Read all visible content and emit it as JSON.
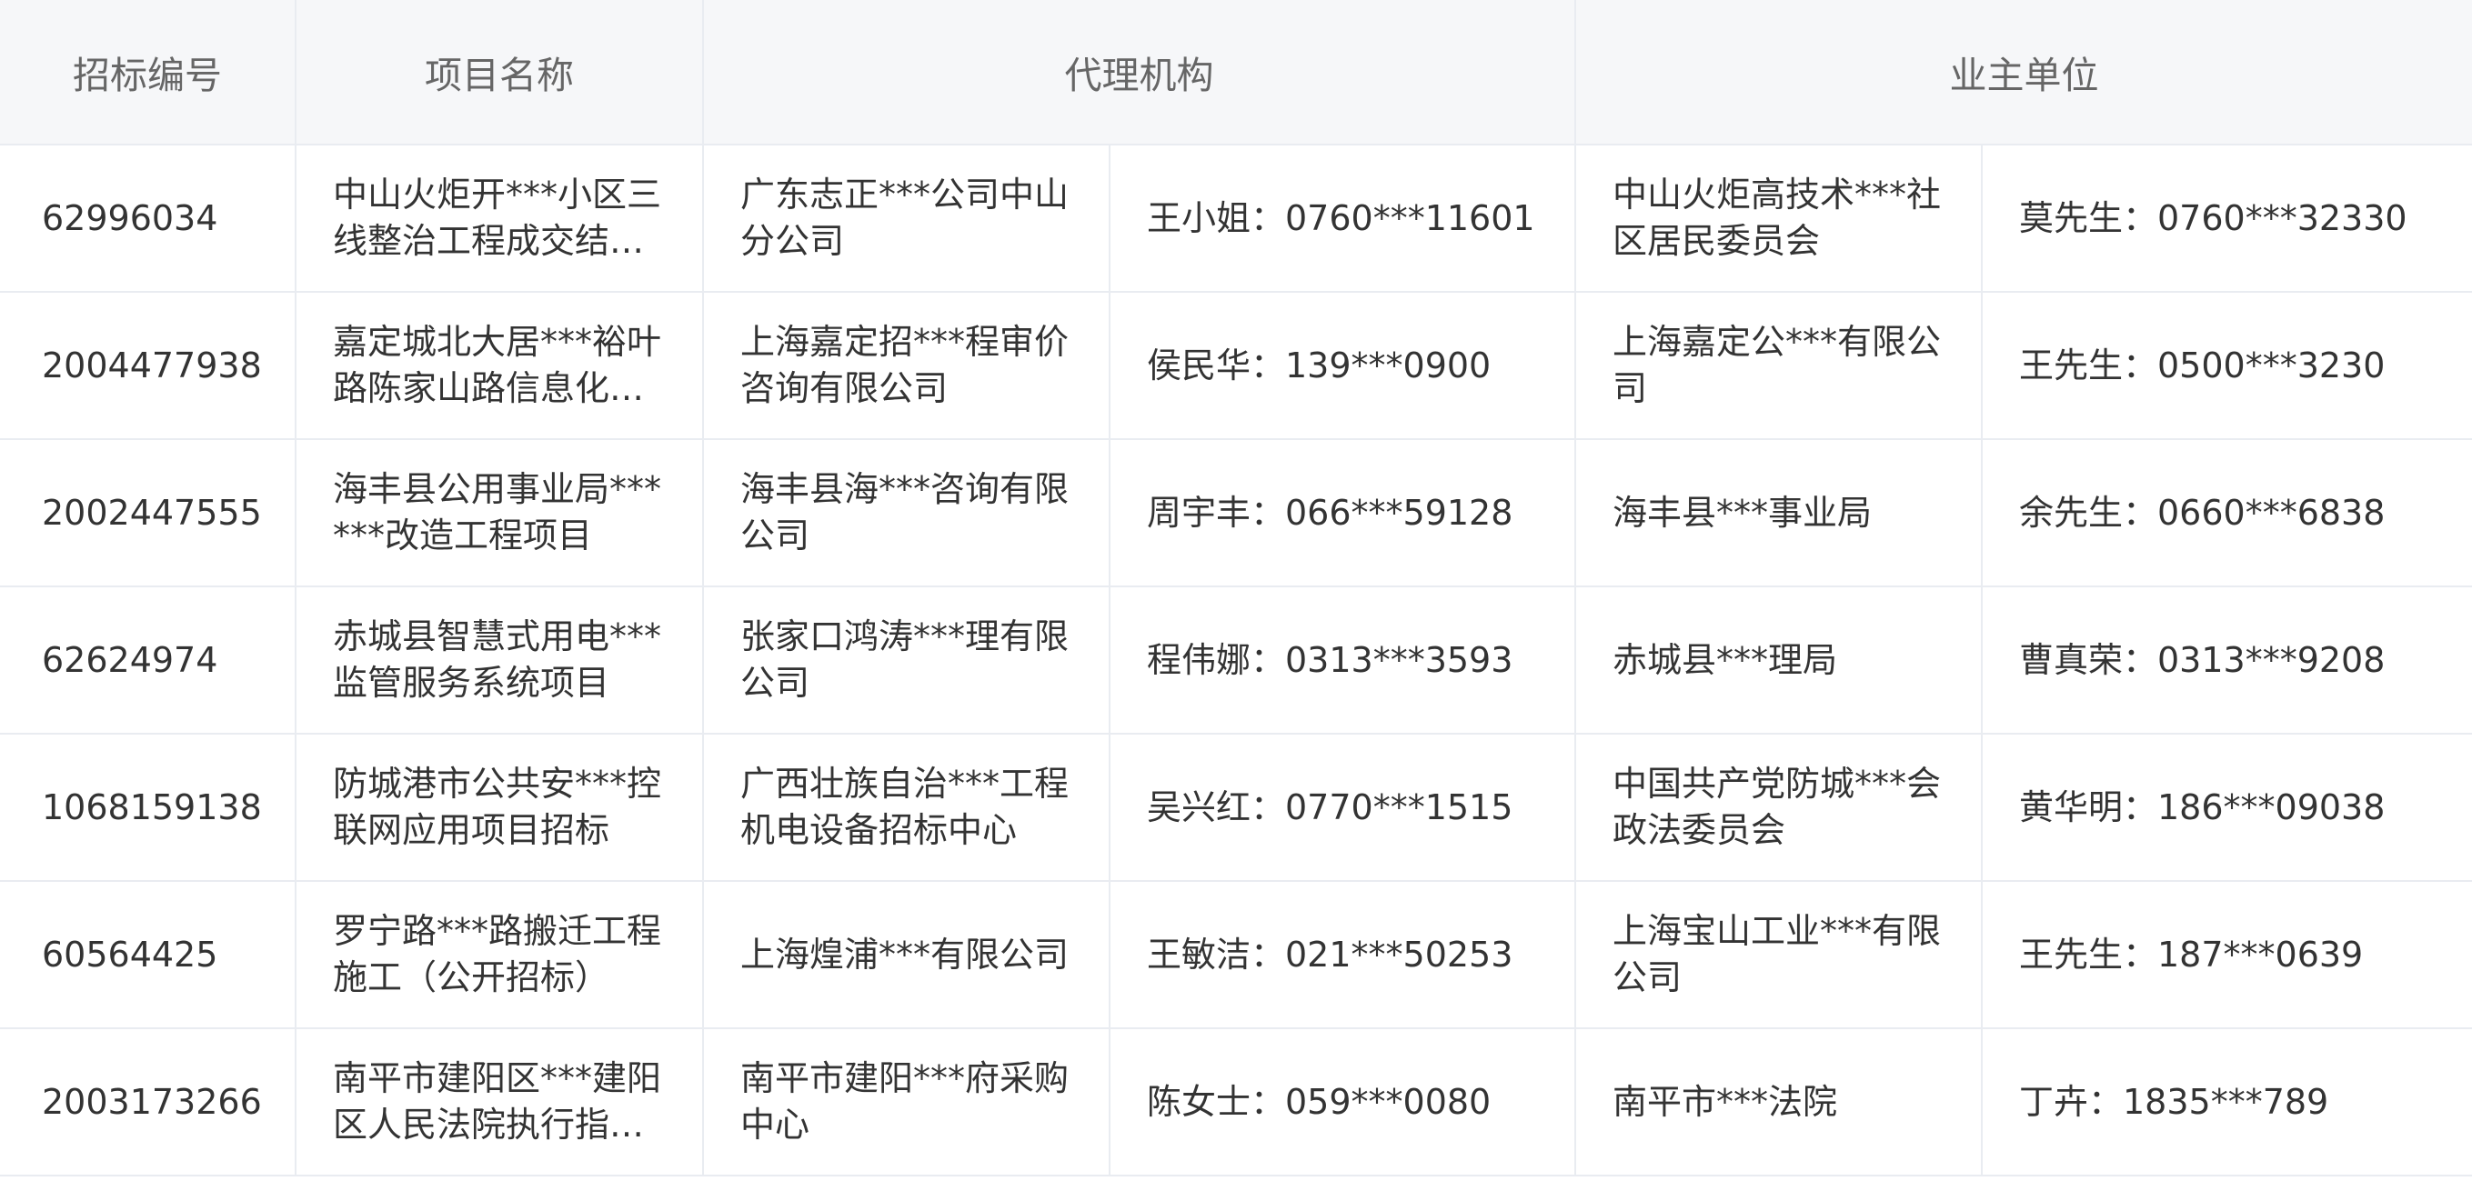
{
  "headers": {
    "code": "招标编号",
    "project": "项目名称",
    "agency": "代理机构",
    "owner": "业主单位"
  },
  "rows": [
    {
      "code": "62996034",
      "project": "中山火炬开***小区三线整治工程成交结果公告",
      "agency": "广东志正***公司中山分公司",
      "agency_contact": "王小姐：0760***11601",
      "owner": "中山火炬高技术***社区居民委员会",
      "owner_contact": "莫先生：0760***32330"
    },
    {
      "code": "2004477938",
      "project": "嘉定城北大居***裕叶路陈家山路信息化工程",
      "agency": "上海嘉定招***程审价咨询有限公司",
      "agency_contact": "侯民华：139***0900",
      "owner": "上海嘉定公***有限公司",
      "owner_contact": "王先生：0500***3230"
    },
    {
      "code": "2002447555",
      "project": "海丰县公用事业局******改造工程项目",
      "agency": "海丰县海***咨询有限公司",
      "agency_contact": "周宇丰：066***59128",
      "owner": "海丰县***事业局",
      "owner_contact": "余先生：0660***6838"
    },
    {
      "code": "62624974",
      "project": "赤城县智慧式用电***监管服务系统项目",
      "agency": "张家口鸿涛***理有限公司",
      "agency_contact": "程伟娜：0313***3593",
      "owner": "赤城县***理局",
      "owner_contact": "曹真荣：0313***9208"
    },
    {
      "code": "1068159138",
      "project": "防城港市公共安***控联网应用项目招标",
      "agency": "广西壮族自治***工程机电设备招标中心",
      "agency_contact": "吴兴红：0770***1515",
      "owner": "中国共产党防城***会政法委员会",
      "owner_contact": "黄华明：186***09038"
    },
    {
      "code": "60564425",
      "project": "罗宁路***路搬迁工程 施工（公开招标）",
      "agency": "上海煌浦***有限公司",
      "agency_contact": "王敏洁：021***50253",
      "owner": "上海宝山工业***有限公司",
      "owner_contact": "王先生：187***0639"
    },
    {
      "code": "2003173266",
      "project": "南平市建阳区***建阳区人民法院执行指挥中心",
      "agency": "南平市建阳***府采购中心",
      "agency_contact": "陈女士：059***0080",
      "owner": "南平市***法院",
      "owner_contact": "丁卉：1835***789"
    }
  ]
}
